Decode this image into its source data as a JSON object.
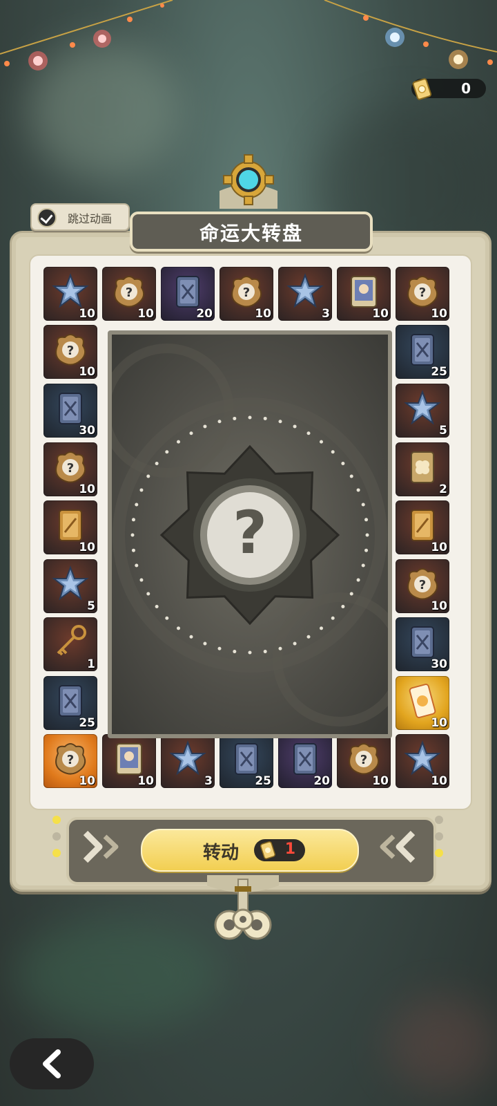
{
  "currency": {
    "icon": "ticket-icon",
    "value": "0"
  },
  "skip_animation": {
    "label": "跳过动画",
    "checked": true
  },
  "title": "命运大转盘",
  "board_cells": [
    {
      "item": "star-badge-icon",
      "color": "red",
      "count": "10"
    },
    {
      "item": "mystery-bag-icon",
      "color": "red",
      "count": "10"
    },
    {
      "item": "card-icon",
      "color": "purple",
      "count": "20"
    },
    {
      "item": "mystery-bag-icon",
      "color": "red",
      "count": "10"
    },
    {
      "item": "star-badge-icon",
      "color": "red",
      "count": "3"
    },
    {
      "item": "photo-card-icon",
      "color": "red",
      "count": "10"
    },
    {
      "item": "mystery-bag-icon",
      "color": "red",
      "count": "10"
    },
    {
      "item": "mystery-bag-icon",
      "color": "red",
      "count": "10"
    },
    {
      "item": "card-icon",
      "color": "blue",
      "count": "25"
    },
    {
      "item": "card-icon",
      "color": "blue",
      "count": "30"
    },
    {
      "item": "star-badge-icon",
      "color": "red",
      "count": "5"
    },
    {
      "item": "mystery-bag-icon",
      "color": "red",
      "count": "10"
    },
    {
      "item": "clover-card-icon",
      "color": "red",
      "count": "2"
    },
    {
      "item": "gold-card-icon",
      "color": "red",
      "count": "10"
    },
    {
      "item": "gold-card-icon",
      "color": "red",
      "count": "10"
    },
    {
      "item": "star-badge-icon",
      "color": "red",
      "count": "5"
    },
    {
      "item": "mystery-bag-icon",
      "color": "red",
      "count": "10"
    },
    {
      "item": "key-icon",
      "color": "red",
      "count": "1"
    },
    {
      "item": "card-icon",
      "color": "blue",
      "count": "30"
    },
    {
      "item": "card-icon",
      "color": "blue",
      "count": "25"
    },
    {
      "item": "ticket-icon",
      "color": "sel",
      "count": "10"
    },
    {
      "item": "mystery-bag-icon",
      "color": "sel-orange",
      "count": "10"
    },
    {
      "item": "photo-card-icon",
      "color": "red",
      "count": "10"
    },
    {
      "item": "star-badge-icon",
      "color": "red",
      "count": "3"
    },
    {
      "item": "card-icon",
      "color": "blue",
      "count": "25"
    },
    {
      "item": "card-icon",
      "color": "purple",
      "count": "20"
    },
    {
      "item": "mystery-bag-icon",
      "color": "red",
      "count": "10"
    },
    {
      "item": "star-badge-icon",
      "color": "red",
      "count": "10"
    }
  ],
  "center": {
    "symbol": "?"
  },
  "spin": {
    "label": "转动",
    "cost": "1",
    "cost_icon": "ticket-icon"
  },
  "indicator_lights": {
    "left": [
      "on",
      "off",
      "on"
    ],
    "right": [
      "off",
      "off",
      "on"
    ]
  },
  "colors": {
    "accent": "#f2cf52",
    "frame": "#d8d1b7",
    "cost_text": "#ff4a3a"
  }
}
